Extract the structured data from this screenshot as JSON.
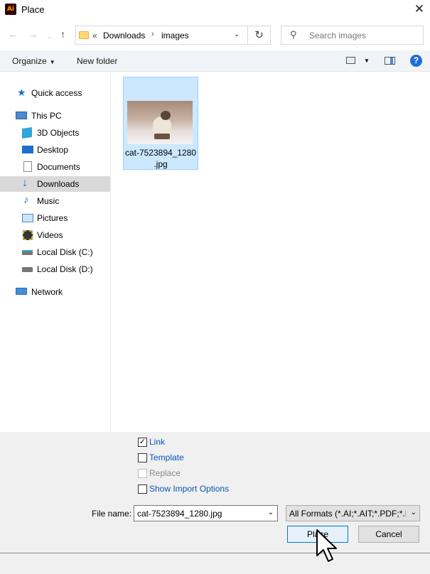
{
  "window": {
    "title": "Place",
    "app_icon": "Ai",
    "close_icon": "close-icon"
  },
  "nav": {
    "breadcrumb": [
      "Downloads",
      "images"
    ],
    "overflow": "«",
    "search_placeholder": "Search images"
  },
  "toolbar": {
    "organize_label": "Organize",
    "new_folder_label": "New folder"
  },
  "sidebar": {
    "items": [
      {
        "label": "Quick access",
        "icon": "star-icon",
        "color": "#1e6ed0"
      },
      {
        "label": "This PC",
        "icon": "computer-icon",
        "color": "#4a8bd0"
      },
      {
        "label": "3D Objects",
        "icon": "cube-icon",
        "color": "#2fa7d8"
      },
      {
        "label": "Desktop",
        "icon": "desktop-icon",
        "color": "#1e6ed0"
      },
      {
        "label": "Documents",
        "icon": "document-icon",
        "color": "#8a8a8a"
      },
      {
        "label": "Downloads",
        "icon": "download-icon",
        "color": "#1e6ed0",
        "selected": true
      },
      {
        "label": "Music",
        "icon": "music-icon",
        "color": "#1e6ed0"
      },
      {
        "label": "Pictures",
        "icon": "pictures-icon",
        "color": "#4a8bd0"
      },
      {
        "label": "Videos",
        "icon": "video-icon",
        "color": "#333333"
      },
      {
        "label": "Local Disk (C:)",
        "icon": "drive-icon",
        "color": "#666666"
      },
      {
        "label": "Local Disk (D:)",
        "icon": "drive-icon",
        "color": "#666666"
      },
      {
        "label": "Network",
        "icon": "network-icon",
        "color": "#1e6ed0"
      }
    ]
  },
  "files": [
    {
      "name_line1": "cat-7523894_1280",
      "name_line2": ".jpg",
      "selected": true
    }
  ],
  "options": {
    "link": {
      "label": "Link",
      "checked": true
    },
    "template": {
      "label": "Template",
      "checked": false
    },
    "replace": {
      "label": "Replace",
      "checked": false,
      "disabled": true
    },
    "show_import": {
      "label": "Show Import Options",
      "checked": false
    }
  },
  "file_name": {
    "label": "File name:",
    "value": "cat-7523894_1280.jpg"
  },
  "filter": {
    "value": "All Formats (*.AI;*.AIT;*.PDF;*.D"
  },
  "buttons": {
    "place": "Place",
    "cancel": "Cancel"
  },
  "colors": {
    "accent": "#0078d7",
    "selection": "#cce8ff",
    "link": "#0a55b6"
  }
}
